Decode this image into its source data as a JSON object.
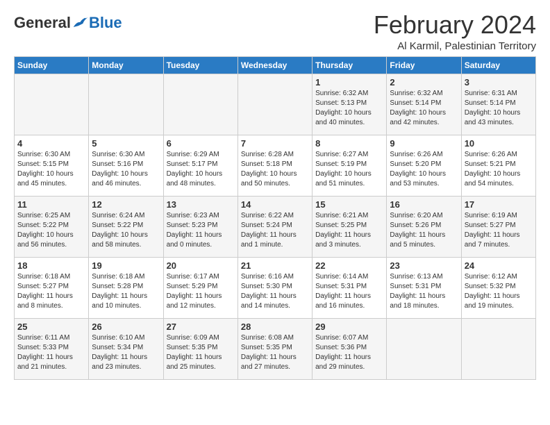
{
  "header": {
    "logo_general": "General",
    "logo_blue": "Blue",
    "month_title": "February 2024",
    "location": "Al Karmil, Palestinian Territory"
  },
  "days_of_week": [
    "Sunday",
    "Monday",
    "Tuesday",
    "Wednesday",
    "Thursday",
    "Friday",
    "Saturday"
  ],
  "weeks": [
    [
      {
        "day": "",
        "sunrise": "",
        "sunset": "",
        "daylight": ""
      },
      {
        "day": "",
        "sunrise": "",
        "sunset": "",
        "daylight": ""
      },
      {
        "day": "",
        "sunrise": "",
        "sunset": "",
        "daylight": ""
      },
      {
        "day": "",
        "sunrise": "",
        "sunset": "",
        "daylight": ""
      },
      {
        "day": "1",
        "sunrise": "Sunrise: 6:32 AM",
        "sunset": "Sunset: 5:13 PM",
        "daylight": "Daylight: 10 hours and 40 minutes."
      },
      {
        "day": "2",
        "sunrise": "Sunrise: 6:32 AM",
        "sunset": "Sunset: 5:14 PM",
        "daylight": "Daylight: 10 hours and 42 minutes."
      },
      {
        "day": "3",
        "sunrise": "Sunrise: 6:31 AM",
        "sunset": "Sunset: 5:14 PM",
        "daylight": "Daylight: 10 hours and 43 minutes."
      }
    ],
    [
      {
        "day": "4",
        "sunrise": "Sunrise: 6:30 AM",
        "sunset": "Sunset: 5:15 PM",
        "daylight": "Daylight: 10 hours and 45 minutes."
      },
      {
        "day": "5",
        "sunrise": "Sunrise: 6:30 AM",
        "sunset": "Sunset: 5:16 PM",
        "daylight": "Daylight: 10 hours and 46 minutes."
      },
      {
        "day": "6",
        "sunrise": "Sunrise: 6:29 AM",
        "sunset": "Sunset: 5:17 PM",
        "daylight": "Daylight: 10 hours and 48 minutes."
      },
      {
        "day": "7",
        "sunrise": "Sunrise: 6:28 AM",
        "sunset": "Sunset: 5:18 PM",
        "daylight": "Daylight: 10 hours and 50 minutes."
      },
      {
        "day": "8",
        "sunrise": "Sunrise: 6:27 AM",
        "sunset": "Sunset: 5:19 PM",
        "daylight": "Daylight: 10 hours and 51 minutes."
      },
      {
        "day": "9",
        "sunrise": "Sunrise: 6:26 AM",
        "sunset": "Sunset: 5:20 PM",
        "daylight": "Daylight: 10 hours and 53 minutes."
      },
      {
        "day": "10",
        "sunrise": "Sunrise: 6:26 AM",
        "sunset": "Sunset: 5:21 PM",
        "daylight": "Daylight: 10 hours and 54 minutes."
      }
    ],
    [
      {
        "day": "11",
        "sunrise": "Sunrise: 6:25 AM",
        "sunset": "Sunset: 5:22 PM",
        "daylight": "Daylight: 10 hours and 56 minutes."
      },
      {
        "day": "12",
        "sunrise": "Sunrise: 6:24 AM",
        "sunset": "Sunset: 5:22 PM",
        "daylight": "Daylight: 10 hours and 58 minutes."
      },
      {
        "day": "13",
        "sunrise": "Sunrise: 6:23 AM",
        "sunset": "Sunset: 5:23 PM",
        "daylight": "Daylight: 11 hours and 0 minutes."
      },
      {
        "day": "14",
        "sunrise": "Sunrise: 6:22 AM",
        "sunset": "Sunset: 5:24 PM",
        "daylight": "Daylight: 11 hours and 1 minute."
      },
      {
        "day": "15",
        "sunrise": "Sunrise: 6:21 AM",
        "sunset": "Sunset: 5:25 PM",
        "daylight": "Daylight: 11 hours and 3 minutes."
      },
      {
        "day": "16",
        "sunrise": "Sunrise: 6:20 AM",
        "sunset": "Sunset: 5:26 PM",
        "daylight": "Daylight: 11 hours and 5 minutes."
      },
      {
        "day": "17",
        "sunrise": "Sunrise: 6:19 AM",
        "sunset": "Sunset: 5:27 PM",
        "daylight": "Daylight: 11 hours and 7 minutes."
      }
    ],
    [
      {
        "day": "18",
        "sunrise": "Sunrise: 6:18 AM",
        "sunset": "Sunset: 5:27 PM",
        "daylight": "Daylight: 11 hours and 8 minutes."
      },
      {
        "day": "19",
        "sunrise": "Sunrise: 6:18 AM",
        "sunset": "Sunset: 5:28 PM",
        "daylight": "Daylight: 11 hours and 10 minutes."
      },
      {
        "day": "20",
        "sunrise": "Sunrise: 6:17 AM",
        "sunset": "Sunset: 5:29 PM",
        "daylight": "Daylight: 11 hours and 12 minutes."
      },
      {
        "day": "21",
        "sunrise": "Sunrise: 6:16 AM",
        "sunset": "Sunset: 5:30 PM",
        "daylight": "Daylight: 11 hours and 14 minutes."
      },
      {
        "day": "22",
        "sunrise": "Sunrise: 6:14 AM",
        "sunset": "Sunset: 5:31 PM",
        "daylight": "Daylight: 11 hours and 16 minutes."
      },
      {
        "day": "23",
        "sunrise": "Sunrise: 6:13 AM",
        "sunset": "Sunset: 5:31 PM",
        "daylight": "Daylight: 11 hours and 18 minutes."
      },
      {
        "day": "24",
        "sunrise": "Sunrise: 6:12 AM",
        "sunset": "Sunset: 5:32 PM",
        "daylight": "Daylight: 11 hours and 19 minutes."
      }
    ],
    [
      {
        "day": "25",
        "sunrise": "Sunrise: 6:11 AM",
        "sunset": "Sunset: 5:33 PM",
        "daylight": "Daylight: 11 hours and 21 minutes."
      },
      {
        "day": "26",
        "sunrise": "Sunrise: 6:10 AM",
        "sunset": "Sunset: 5:34 PM",
        "daylight": "Daylight: 11 hours and 23 minutes."
      },
      {
        "day": "27",
        "sunrise": "Sunrise: 6:09 AM",
        "sunset": "Sunset: 5:35 PM",
        "daylight": "Daylight: 11 hours and 25 minutes."
      },
      {
        "day": "28",
        "sunrise": "Sunrise: 6:08 AM",
        "sunset": "Sunset: 5:35 PM",
        "daylight": "Daylight: 11 hours and 27 minutes."
      },
      {
        "day": "29",
        "sunrise": "Sunrise: 6:07 AM",
        "sunset": "Sunset: 5:36 PM",
        "daylight": "Daylight: 11 hours and 29 minutes."
      },
      {
        "day": "",
        "sunrise": "",
        "sunset": "",
        "daylight": ""
      },
      {
        "day": "",
        "sunrise": "",
        "sunset": "",
        "daylight": ""
      }
    ]
  ]
}
